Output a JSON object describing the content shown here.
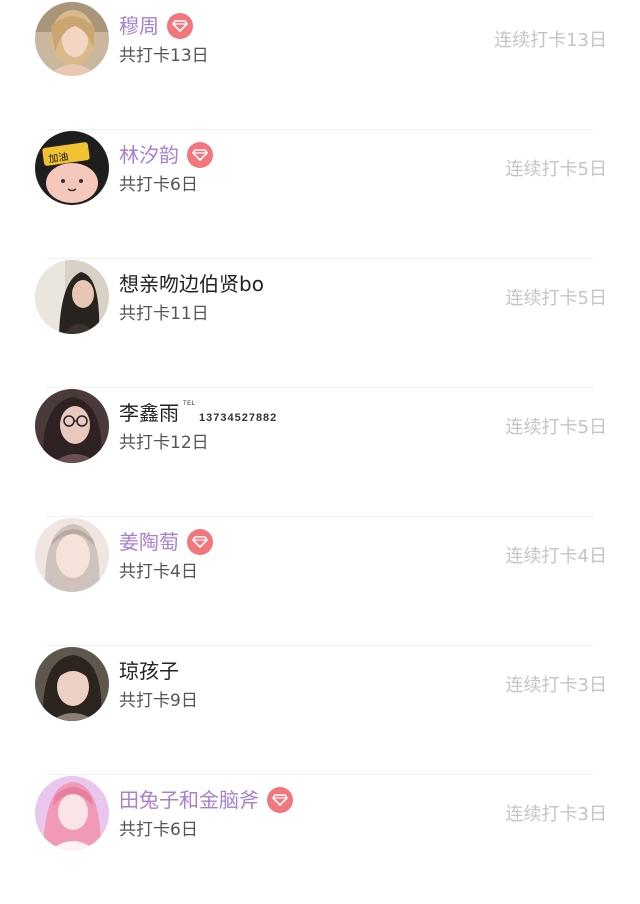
{
  "users": [
    {
      "name": "穆周",
      "vip": true,
      "total": "共打卡13日",
      "streak": "连续打卡13日",
      "avatar": "avatar-blonde-woman"
    },
    {
      "name": "林汐韵",
      "vip": true,
      "total": "共打卡6日",
      "streak": "连续打卡5日",
      "avatar": "avatar-cartoon-cat",
      "avatar_text": "加油"
    },
    {
      "name": "想亲吻边伯贤bo",
      "vip": false,
      "total": "共打卡11日",
      "streak": "连续打卡5日",
      "avatar": "avatar-dark-hair-woman"
    },
    {
      "name": "李鑫雨",
      "vip": false,
      "total": "共打卡12日",
      "streak": "连续打卡5日",
      "avatar": "avatar-woman-glasses",
      "tel_tag": "TEL",
      "tel_number": "13734527882"
    },
    {
      "name": "姜陶萄",
      "vip": true,
      "total": "共打卡4日",
      "streak": "连续打卡4日",
      "avatar": "avatar-light-portrait"
    },
    {
      "name": "琼孩子",
      "vip": false,
      "total": "共打卡9日",
      "streak": "连续打卡3日",
      "avatar": "avatar-girl-bangs"
    },
    {
      "name": "田兔子和金脑斧",
      "vip": true,
      "total": "共打卡6日",
      "streak": "连续打卡3日",
      "avatar": "avatar-pink-anime"
    }
  ],
  "colors": {
    "vip_name": "#a97fd0",
    "vip_badge": "#f2767b",
    "streak_text": "#c4c4c6"
  },
  "icons": {
    "vip_badge": "diamond-icon"
  }
}
